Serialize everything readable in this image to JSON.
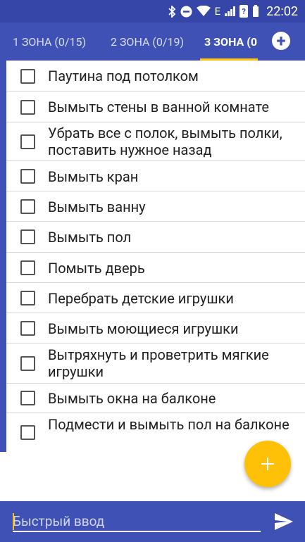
{
  "status_bar": {
    "time": "22:02",
    "network_label": "E",
    "battery_label": "?"
  },
  "tabs": [
    {
      "label": "1 ЗОНА (0/15)",
      "active": false
    },
    {
      "label": "2 ЗОНА (0/19)",
      "active": false
    },
    {
      "label": "3 ЗОНА (0",
      "active": true
    }
  ],
  "tasks": [
    {
      "label": "Паутина под потолком",
      "checked": false
    },
    {
      "label": "Вымыть стены в ванной комнате",
      "checked": false
    },
    {
      "label": "Убрать все с полок, вымыть полки, поставить нужное назад",
      "checked": false
    },
    {
      "label": "Вымыть кран",
      "checked": false
    },
    {
      "label": "Вымыть ванну",
      "checked": false
    },
    {
      "label": "Вымыть пол",
      "checked": false
    },
    {
      "label": "Помыть дверь",
      "checked": false
    },
    {
      "label": "Перебрать детские игрушки",
      "checked": false
    },
    {
      "label": "Вымыть моющиеся игрушки",
      "checked": false
    },
    {
      "label": "Вытряхнуть и проветрить мягкие игрушки",
      "checked": false
    },
    {
      "label": "Вымыть окна на балконе",
      "checked": false
    },
    {
      "label": "Подмести и вымыть пол на балконе",
      "checked": false
    }
  ],
  "quick_input": {
    "placeholder": "Быстрый ввод",
    "value": ""
  },
  "icons": {
    "add_zone": "plus-circle-icon",
    "fab": "plus-icon",
    "send": "send-icon"
  },
  "colors": {
    "primary": "#3f51b5",
    "status_bar": "#3545a8",
    "accent": "#ffc107"
  }
}
